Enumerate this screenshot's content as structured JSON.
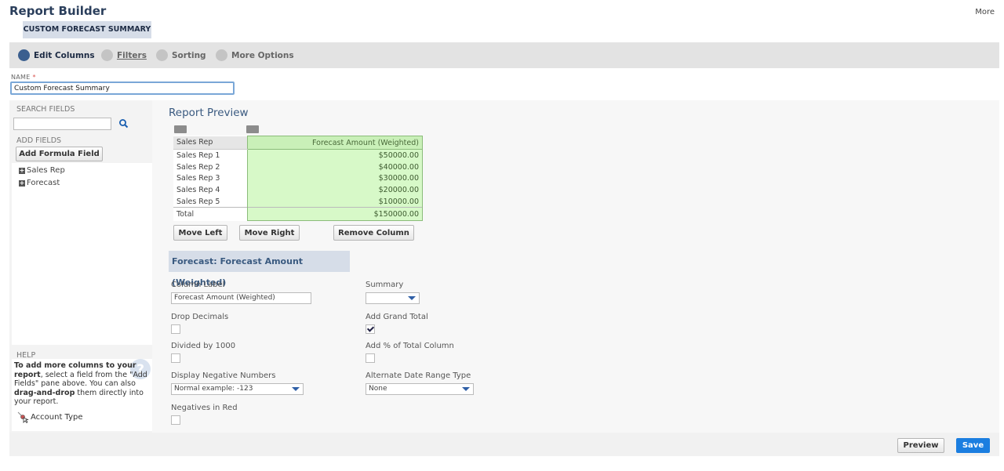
{
  "header": {
    "app_title": "Report Builder",
    "more_label": "More",
    "report_tab": "CUSTOM FORECAST SUMMARY"
  },
  "steps": [
    {
      "label": "Edit Columns",
      "active": true
    },
    {
      "label": "Filters",
      "active": false
    },
    {
      "label": "Sorting",
      "active": false
    },
    {
      "label": "More Options",
      "active": false
    }
  ],
  "name_field": {
    "label": "NAME",
    "required_mark": "*",
    "value": "Custom Forecast Summary"
  },
  "left_panel": {
    "search_label": "SEARCH FIELDS",
    "search_icon": "search-icon",
    "add_fields_label": "ADD FIELDS",
    "add_formula_button": "Add Formula Field",
    "tree": [
      {
        "label": "Sales Rep"
      },
      {
        "label": "Forecast"
      }
    ],
    "help": {
      "label": "HELP",
      "text_parts": [
        {
          "text": "To add more columns to your report",
          "bold": true
        },
        {
          "text": ", select a field from the \"Add Fields\" pane above. You can also ",
          "bold": false
        },
        {
          "text": "drag-and-drop",
          "bold": true
        },
        {
          "text": " them directly into your report.",
          "bold": false
        }
      ],
      "hint_label": "Account Type"
    }
  },
  "preview": {
    "title": "Report Preview",
    "columns": [
      "Sales Rep",
      "Forecast Amount (Weighted)"
    ],
    "rows": [
      [
        "Sales Rep 1",
        "$50000.00"
      ],
      [
        "Sales Rep 2",
        "$40000.00"
      ],
      [
        "Sales Rep 3",
        "$30000.00"
      ],
      [
        "Sales Rep 4",
        "$20000.00"
      ],
      [
        "Sales Rep 5",
        "$10000.00"
      ]
    ],
    "total_row": [
      "Total",
      "$150000.00"
    ],
    "buttons": {
      "move_left": "Move Left",
      "move_right": "Move Right",
      "remove_column": "Remove Column"
    }
  },
  "column_settings": {
    "header": "Forecast: Forecast Amount (Weighted)",
    "column_label": {
      "label": "Column Label",
      "value": "Forecast Amount (Weighted)"
    },
    "summary": {
      "label": "Summary",
      "value": ""
    },
    "drop_decimals": {
      "label": "Drop Decimals",
      "checked": false
    },
    "add_grand_total": {
      "label": "Add Grand Total",
      "checked": true
    },
    "divided_by_1000": {
      "label": "Divided by 1000",
      "checked": false
    },
    "add_pct_total": {
      "label": "Add % of Total Column",
      "checked": false
    },
    "display_negative": {
      "label": "Display Negative Numbers",
      "value": "Normal  example: -123"
    },
    "alt_date_range": {
      "label": "Alternate Date Range Type",
      "value": "None"
    },
    "negatives_in_red": {
      "label": "Negatives in Red",
      "checked": false
    }
  },
  "footer": {
    "preview_button": "Preview",
    "save_button": "Save"
  },
  "colors": {
    "accent": "#1b7ee0",
    "step_active": "#3b5f8f",
    "selected_column": "#d7f9c8",
    "section_header": "#d6dde8"
  }
}
